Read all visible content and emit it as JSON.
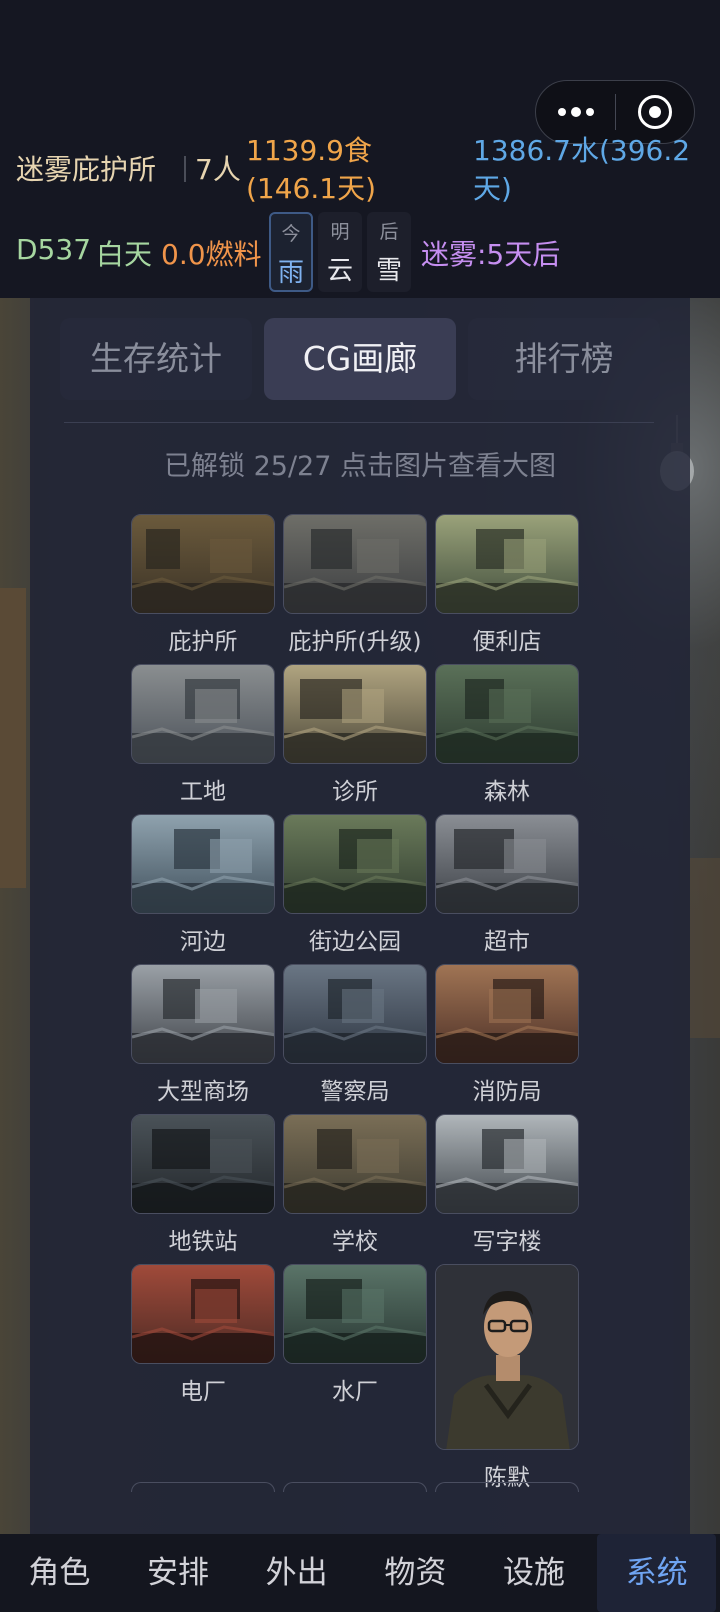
{
  "header": {
    "shelter_name": "迷雾庇护所",
    "population": "7人",
    "food": "1139.9食(146.1天)",
    "water": "1386.7水(396.2天)",
    "day": "D537",
    "daytime": "白天",
    "fuel": "0.0燃料",
    "weather": [
      {
        "label": "今",
        "value": "雨"
      },
      {
        "label": "明",
        "value": "云"
      },
      {
        "label": "后",
        "value": "雪"
      }
    ],
    "fog": "迷雾:5天后"
  },
  "tabs": [
    "生存统计",
    "CG画廊",
    "排行榜"
  ],
  "active_tab": "CG画廊",
  "gallery": {
    "unlock_text": "已解锁 25/27  点击图片查看大图",
    "items": [
      {
        "name": "庇护所"
      },
      {
        "name": "庇护所(升级)"
      },
      {
        "name": "便利店"
      },
      {
        "name": "工地"
      },
      {
        "name": "诊所"
      },
      {
        "name": "森林"
      },
      {
        "name": "河边"
      },
      {
        "name": "街边公园"
      },
      {
        "name": "超市"
      },
      {
        "name": "大型商场"
      },
      {
        "name": "警察局"
      },
      {
        "name": "消防局"
      },
      {
        "name": "地铁站"
      },
      {
        "name": "学校"
      },
      {
        "name": "写字楼"
      },
      {
        "name": "电厂"
      },
      {
        "name": "水厂"
      },
      {
        "name": "陈默"
      }
    ]
  },
  "bottom_nav": [
    "角色",
    "安排",
    "外出",
    "物资",
    "设施",
    "系统"
  ],
  "active_nav": "系统",
  "colors": {
    "food": "#f0a54a",
    "water": "#5fa8e6",
    "day": "#a6d6a0",
    "fuel": "#f0944a",
    "fog": "#c58ef0",
    "nav_active": "#6fa4f2"
  }
}
